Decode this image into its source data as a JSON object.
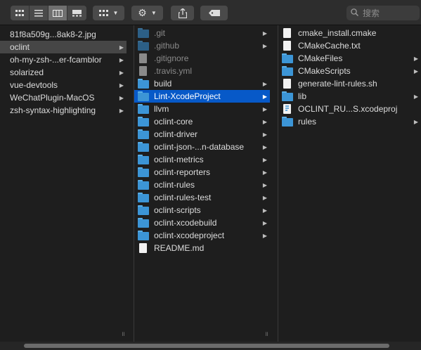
{
  "search": {
    "placeholder": "搜索"
  },
  "column1": {
    "items": [
      {
        "label": "81f8a509g...8ak8-2.jpg",
        "arrow": false
      },
      {
        "label": "oclint",
        "arrow": true
      },
      {
        "label": "oh-my-zsh-...er-fcamblor",
        "arrow": true
      },
      {
        "label": "solarized",
        "arrow": true
      },
      {
        "label": "vue-devtools",
        "arrow": true
      },
      {
        "label": "WeChatPlugin-MacOS",
        "arrow": true
      },
      {
        "label": "zsh-syntax-highlighting",
        "arrow": true
      }
    ]
  },
  "column2": {
    "items": [
      {
        "label": ".git",
        "icon": "folder-icon",
        "arrow": true
      },
      {
        "label": ".github",
        "icon": "folder-icon",
        "arrow": true
      },
      {
        "label": ".gitignore",
        "icon": "document-icon",
        "arrow": false
      },
      {
        "label": ".travis.yml",
        "icon": "document-icon",
        "arrow": false
      },
      {
        "label": "build",
        "icon": "folder-icon",
        "arrow": true
      },
      {
        "label": "Lint-XcodeProject",
        "icon": "folder-icon",
        "arrow": true
      },
      {
        "label": "llvm",
        "icon": "folder-icon",
        "arrow": true
      },
      {
        "label": "oclint-core",
        "icon": "folder-icon",
        "arrow": true
      },
      {
        "label": "oclint-driver",
        "icon": "folder-icon",
        "arrow": true
      },
      {
        "label": "oclint-json-...n-database",
        "icon": "folder-icon",
        "arrow": true
      },
      {
        "label": "oclint-metrics",
        "icon": "folder-icon",
        "arrow": true
      },
      {
        "label": "oclint-reporters",
        "icon": "folder-icon",
        "arrow": true
      },
      {
        "label": "oclint-rules",
        "icon": "folder-icon",
        "arrow": true
      },
      {
        "label": "oclint-rules-test",
        "icon": "folder-icon",
        "arrow": true
      },
      {
        "label": "oclint-scripts",
        "icon": "folder-icon",
        "arrow": true
      },
      {
        "label": "oclint-xcodebuild",
        "icon": "folder-icon",
        "arrow": true
      },
      {
        "label": "oclint-xcodeproject",
        "icon": "folder-icon",
        "arrow": true
      },
      {
        "label": "README.md",
        "icon": "document-icon",
        "arrow": false
      }
    ]
  },
  "column3": {
    "items": [
      {
        "label": "cmake_install.cmake",
        "icon": "document-icon",
        "arrow": false
      },
      {
        "label": "CMakeCache.txt",
        "icon": "document-icon",
        "arrow": false
      },
      {
        "label": "CMakeFiles",
        "icon": "folder-icon",
        "arrow": true
      },
      {
        "label": "CMakeScripts",
        "icon": "folder-icon",
        "arrow": true
      },
      {
        "label": "generate-lint-rules.sh",
        "icon": "document-icon",
        "arrow": false
      },
      {
        "label": "lib",
        "icon": "folder-icon",
        "arrow": true
      },
      {
        "label": "OCLINT_RU...S.xcodeproj",
        "icon": "xcodeproj-icon",
        "arrow": false
      },
      {
        "label": "rules",
        "icon": "folder-icon",
        "arrow": true
      }
    ]
  },
  "colors": {
    "selection": "#0759c8",
    "folder": "#3c95d6",
    "background": "#1e1e1e"
  }
}
